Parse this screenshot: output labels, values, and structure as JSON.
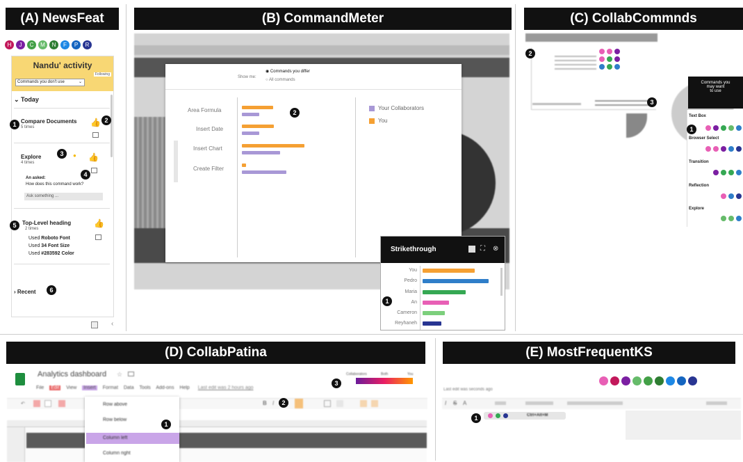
{
  "panels": {
    "a": {
      "title": "(A) NewsFeat",
      "avatars": [
        "H",
        "J",
        "C",
        "M",
        "N",
        "F",
        "P",
        "R"
      ],
      "header": "Nandu' activity",
      "header_tag": "Following",
      "filter": "Commands you don't use",
      "today": "Today",
      "items": [
        {
          "name": "Compare Documents",
          "count": "5 times"
        },
        {
          "name": "Explore",
          "count": "4 times",
          "asked_label": "An asked:",
          "asked_q": "How does this command work?",
          "ask_placeholder": "Ask something ..."
        },
        {
          "name": "Top-Level heading",
          "count": "2 times",
          "details": [
            {
              "pre": "Used ",
              "bold": "Roboto Font",
              "post": ""
            },
            {
              "pre": "Used ",
              "bold": "34 Font Size",
              "post": ""
            },
            {
              "pre": "Used ",
              "bold": "#283592 Color",
              "post": ""
            }
          ]
        }
      ],
      "recent": "Recent"
    },
    "b": {
      "title": "(B) CommandMeter",
      "show_me": "Show me:",
      "radio1": "Commands you differ",
      "radio2": "All commands",
      "commands": [
        "Area Formula",
        "Insert Date",
        "Insert Chart",
        "Create Filter"
      ],
      "legend": [
        "Your Collaborators",
        "You"
      ],
      "popup_title": "Strikethrough",
      "popup_people": [
        "You",
        "Pedro",
        "Maria",
        "An",
        "Cameron",
        "Reyhaneh"
      ]
    },
    "c": {
      "title": "(C) CollabCommnds",
      "tooltip_lines": [
        "Commands you",
        "may want",
        "to use"
      ],
      "sections": [
        "Text Box",
        "Browser Select",
        "Transition",
        "Reflection",
        "Explore"
      ]
    },
    "d": {
      "title": "(D) CollabPatina",
      "doc_title": "Analytics dashboard",
      "menu": [
        "File",
        "Edit",
        "View",
        "Insert",
        "Format",
        "Data",
        "Tools",
        "Add-ons",
        "Help"
      ],
      "last_edit": "Last edit was 2 hours ago",
      "menu_items": [
        "Row above",
        "Row below",
        "Column left",
        "Column right"
      ],
      "heat_labels": [
        "Collaborators",
        "Both",
        "You"
      ]
    },
    "e": {
      "title": "(E) MostFrequentKS",
      "last_edit": "Last edit was seconds ago",
      "shortcut": "Ctrl+Alt+M"
    }
  },
  "colors": {
    "orange": "#f5a033",
    "purple": "#a898d6",
    "pink": "#e85fb5",
    "green": "#35a853",
    "blue": "#2f7ec9",
    "navy": "#283592"
  }
}
